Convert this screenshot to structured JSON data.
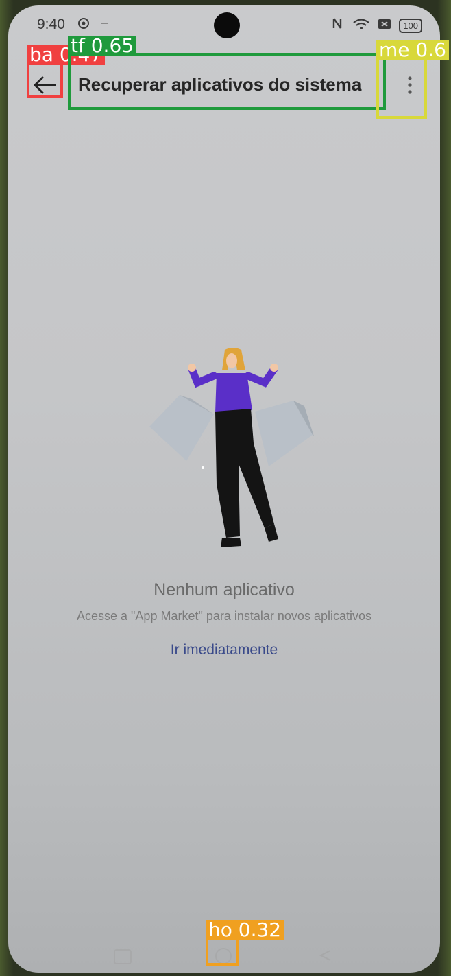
{
  "status_bar": {
    "time": "9:40",
    "battery": "100",
    "icons": [
      "settings-icon",
      "minus-icon",
      "nfc-icon",
      "wifi-icon",
      "sim-off-icon",
      "battery-icon"
    ]
  },
  "app_bar": {
    "title": "Recuperar aplicativos do sistema",
    "back_icon": "arrow-left-icon",
    "menu_icon": "more-vertical-icon"
  },
  "detections": [
    {
      "label": "ba 0.47",
      "color": "#f04040"
    },
    {
      "label": "tf 0.65",
      "color": "#1f9a3c"
    },
    {
      "label": "me 0.6",
      "color": "#d8d83a"
    },
    {
      "label": "ho 0.32",
      "color": "#f0a020"
    }
  ],
  "empty_state": {
    "title": "Nenhum aplicativo",
    "subtitle": "Acesse a \"App Market\" para instalar novos aplicativos",
    "action": "Ir imediatamente"
  },
  "colors": {
    "screen_bg": "#c6c7c9",
    "title_text": "#262626",
    "link": "#3a4a8a",
    "figure_shirt": "#5a2fc8"
  }
}
